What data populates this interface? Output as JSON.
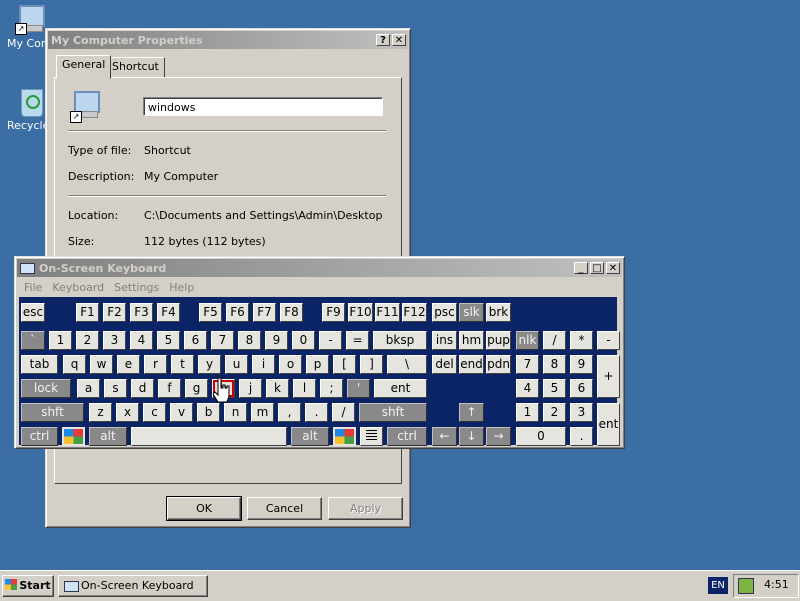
{
  "desktop": {
    "icons": [
      {
        "label": "My Computer"
      },
      {
        "label": "Recycle Bin"
      }
    ]
  },
  "properties": {
    "title": "My Computer Properties",
    "help_btn": "?",
    "close_btn": "✕",
    "tabs": [
      {
        "label": "General"
      },
      {
        "label": "Shortcut"
      }
    ],
    "name_value": "windows",
    "rows": [
      {
        "label": "Type of file:",
        "value": "Shortcut"
      },
      {
        "label": "Description:",
        "value": "My Computer"
      },
      {
        "label": "Location:",
        "value": "C:\\Documents and Settings\\Admin\\Desktop"
      },
      {
        "label": "Size:",
        "value": "112 bytes (112 bytes)"
      }
    ],
    "buttons": {
      "ok": "OK",
      "cancel": "Cancel",
      "apply": "Apply"
    }
  },
  "osk": {
    "title": "On-Screen Keyboard",
    "min_btn": "_",
    "max_btn": "□",
    "close_btn": "✕",
    "menu": [
      {
        "label": "File"
      },
      {
        "label": "Keyboard"
      },
      {
        "label": "Settings"
      },
      {
        "label": "Help"
      }
    ],
    "keys": {
      "esc": "esc",
      "f1": "F1",
      "f2": "F2",
      "f3": "F3",
      "f4": "F4",
      "f5": "F5",
      "f6": "F6",
      "f7": "F7",
      "f8": "F8",
      "f9": "F9",
      "f10": "F10",
      "f11": "F11",
      "f12": "F12",
      "psc": "psc",
      "slk": "slk",
      "brk": "brk",
      "backtick": "`",
      "n1": "1",
      "n2": "2",
      "n3": "3",
      "n4": "4",
      "n5": "5",
      "n6": "6",
      "n7": "7",
      "n8": "8",
      "n9": "9",
      "n0": "0",
      "minus": "-",
      "equals": "=",
      "bksp": "bksp",
      "ins": "ins",
      "hm": "hm",
      "pup": "pup",
      "nlk": "nlk",
      "np_div": "/",
      "np_mul": "*",
      "np_sub": "-",
      "tab": "tab",
      "q": "q",
      "w": "w",
      "e": "e",
      "r": "r",
      "t": "t",
      "y": "y",
      "u": "u",
      "i": "i",
      "o": "o",
      "p": "p",
      "lbr": "[",
      "rbr": "]",
      "bslash": "\\",
      "del": "del",
      "end": "end",
      "pdn": "pdn",
      "np7": "7",
      "np8": "8",
      "np9": "9",
      "np_add": "+",
      "lock": "lock",
      "a": "a",
      "s": "s",
      "d": "d",
      "f": "f",
      "g": "g",
      "h": "h",
      "j": "j",
      "k": "k",
      "l": "l",
      "semi": ";",
      "quote": "'",
      "ent": "ent",
      "np4": "4",
      "np5": "5",
      "np6": "6",
      "shft_l": "shft",
      "z": "z",
      "x": "x",
      "c": "c",
      "v": "v",
      "b": "b",
      "n": "n",
      "m": "m",
      "comma": ",",
      "period": ".",
      "slash": "/",
      "shft_r": "shft",
      "up": "↑",
      "np1": "1",
      "np2": "2",
      "np3": "3",
      "np_ent": "ent",
      "ctrl_l": "ctrl",
      "alt_l": "alt",
      "space": "",
      "alt_r": "alt",
      "ctrl_r": "ctrl",
      "left": "←",
      "down": "↓",
      "right": "→",
      "np0": "0",
      "np_dot": "."
    }
  },
  "taskbar": {
    "start": "Start",
    "task": "On-Screen Keyboard",
    "lang": "EN",
    "time": "4:51"
  },
  "colors": {
    "desktop": "#3a6ea5",
    "keyboard_bg": "#0b2466",
    "title_active": "#0a246a"
  }
}
